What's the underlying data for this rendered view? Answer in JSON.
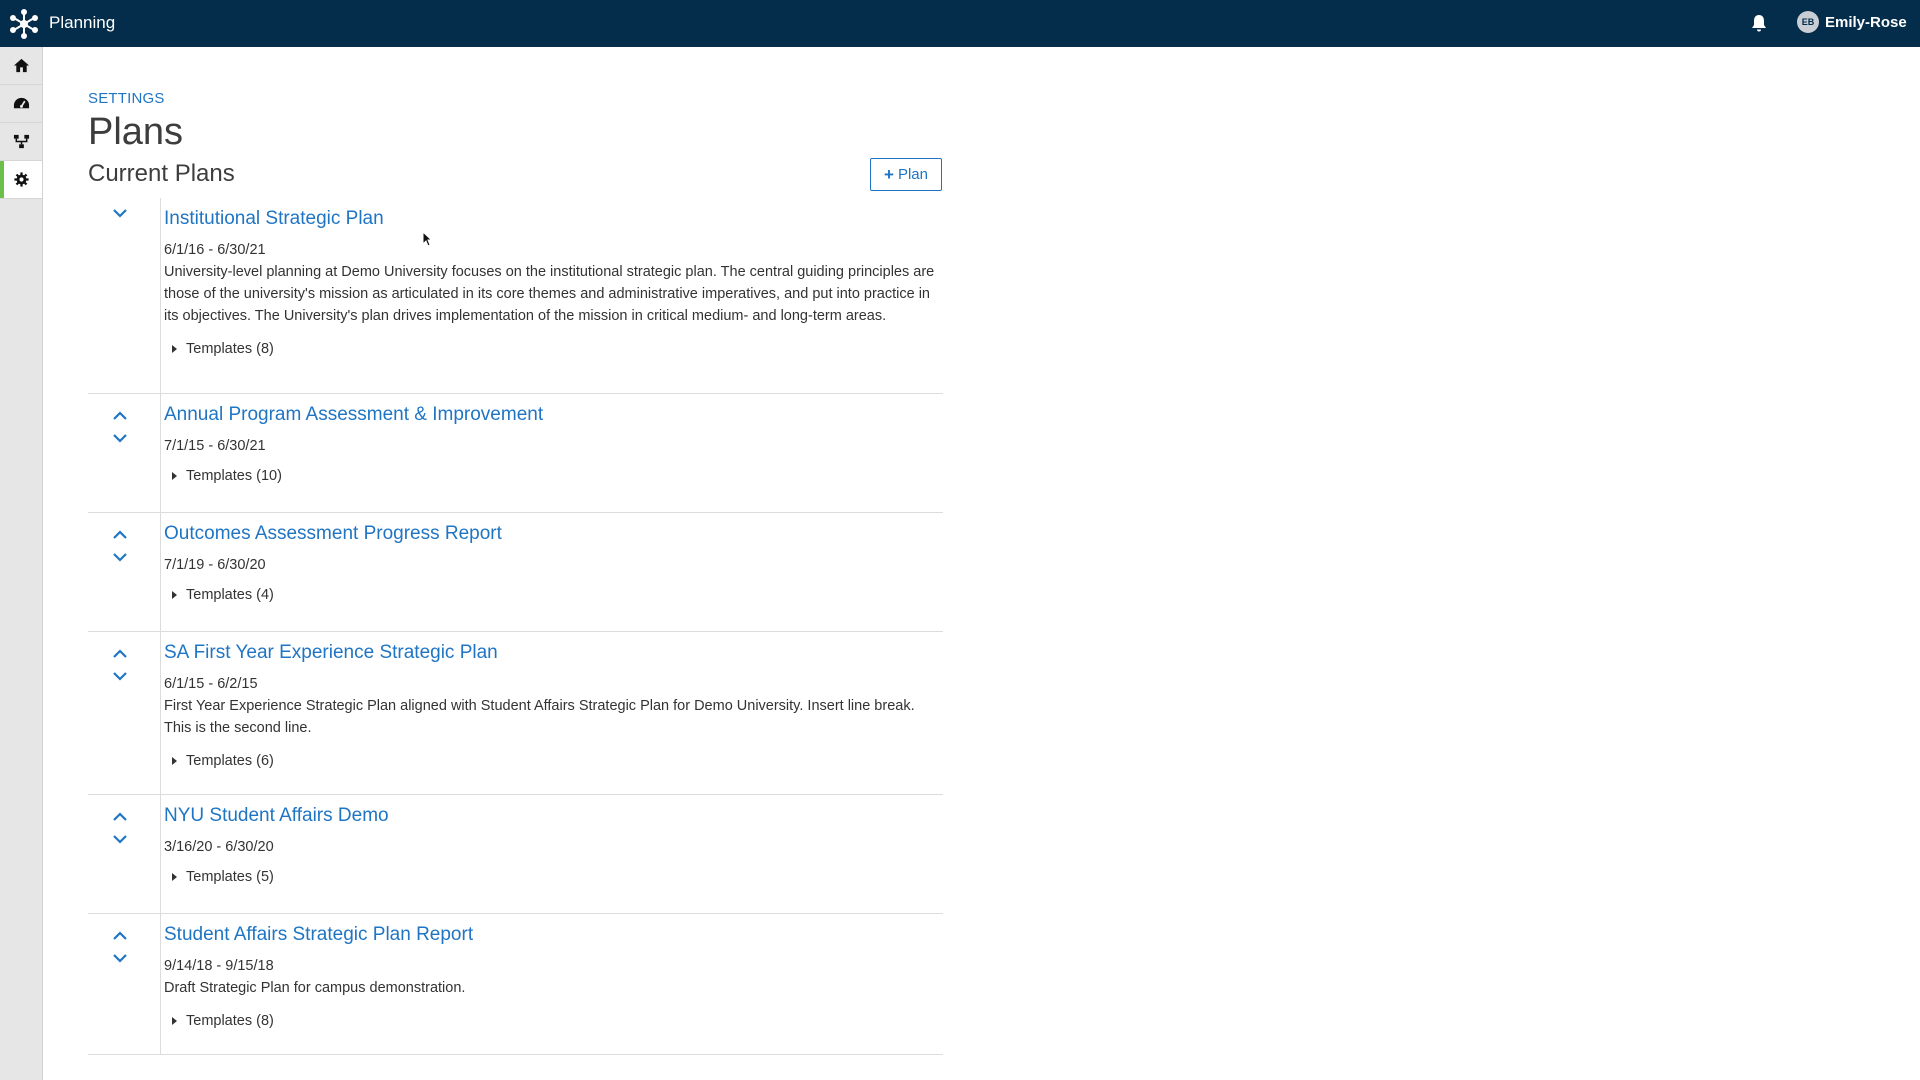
{
  "header": {
    "app_title": "Planning",
    "user_initials": "EB",
    "user_name": "Emily-Rose",
    "logo_icon": "network-logo-icon",
    "notification_icon": "bell-icon"
  },
  "sidebar": {
    "items": [
      {
        "icon": "home-icon",
        "active": false
      },
      {
        "icon": "dashboard-icon",
        "active": false
      },
      {
        "icon": "hierarchy-icon",
        "active": false
      },
      {
        "icon": "gear-icon",
        "active": true
      }
    ],
    "active_color": "#6cc04a"
  },
  "breadcrumb": "SETTINGS",
  "page_title": "Plans",
  "section_title": "Current Plans",
  "add_plan_label": "Plan",
  "colors": {
    "topbar": "#042c4b",
    "link": "#1f75c4"
  },
  "plans": [
    {
      "title": "Institutional Strategic Plan",
      "dates": "6/1/16 - 6/30/21",
      "description": "University-level planning at Demo University focuses on the institutional strategic plan. The central guiding principles are those of the university's mission as articulated in its core themes and administrative imperatives, and put into practice in its objectives. The University's plan drives implementation of the mission in critical medium- and long-term areas.",
      "templates": "Templates (8)",
      "arrows": [
        "down"
      ]
    },
    {
      "title": "Annual Program Assessment & Improvement",
      "dates": "7/1/15 - 6/30/21",
      "description": "",
      "templates": "Templates (10)",
      "arrows": [
        "up",
        "down"
      ]
    },
    {
      "title": "Outcomes Assessment Progress Report",
      "dates": "7/1/19 - 6/30/20",
      "description": "",
      "templates": "Templates (4)",
      "arrows": [
        "up",
        "down"
      ]
    },
    {
      "title": "SA First Year Experience Strategic Plan",
      "dates": "6/1/15 - 6/2/15",
      "description": "First Year Experience Strategic Plan aligned with Student Affairs Strategic Plan for Demo University. Insert line break. This is the second line.",
      "templates": "Templates (6)",
      "arrows": [
        "up",
        "down"
      ]
    },
    {
      "title": "NYU Student Affairs Demo",
      "dates": "3/16/20 - 6/30/20",
      "description": "",
      "templates": "Templates (5)",
      "arrows": [
        "up",
        "down"
      ]
    },
    {
      "title": "Student Affairs Strategic Plan Report",
      "dates": "9/14/18 - 9/15/18",
      "description": "Draft Strategic Plan for campus demonstration.",
      "templates": "Templates (8)",
      "arrows": [
        "up",
        "down"
      ]
    }
  ]
}
